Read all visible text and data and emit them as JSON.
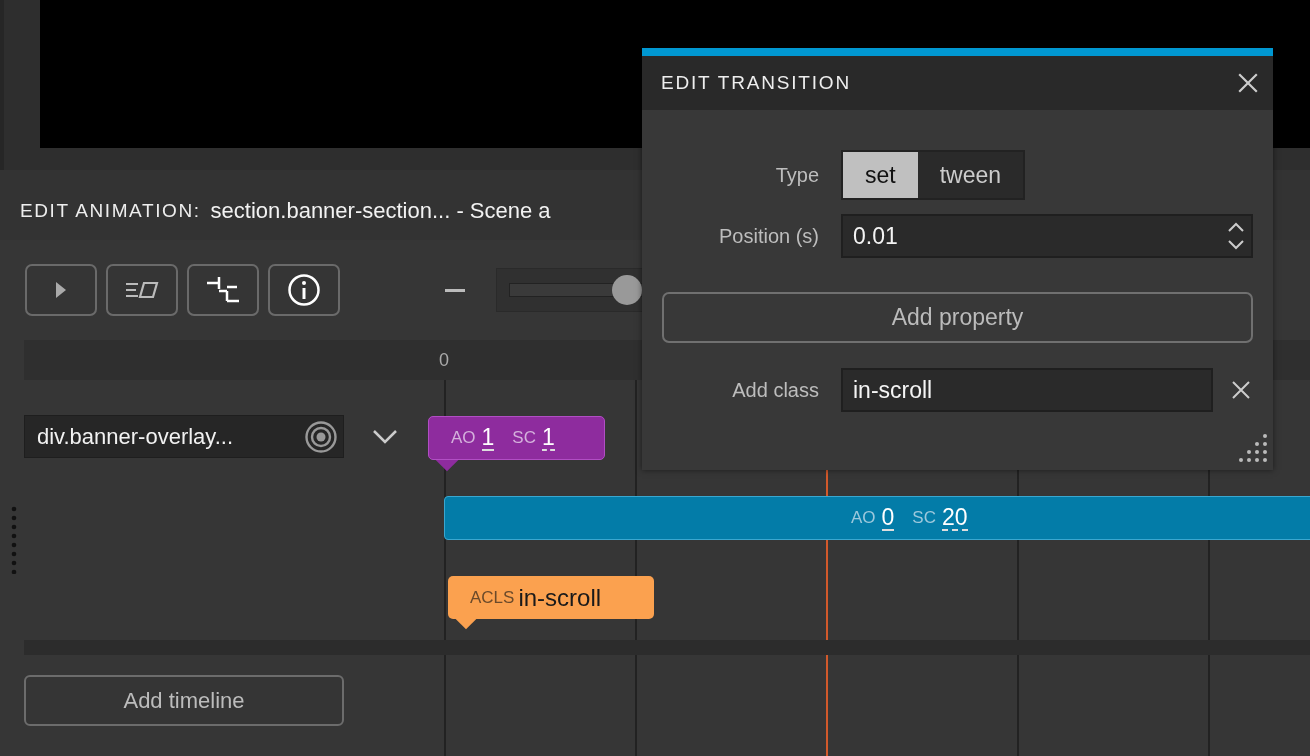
{
  "panel": {
    "heading": "EDIT ANIMATION:",
    "title": "section.banner-section... - Scene a"
  },
  "toolbar": [
    {
      "kind": "play"
    },
    {
      "kind": "ease"
    },
    {
      "kind": "tree"
    },
    {
      "kind": "info"
    }
  ],
  "zoom": {
    "level": 0.83
  },
  "ruler": {
    "labels": [
      "0"
    ]
  },
  "track": {
    "element": "div.banner-overlay..."
  },
  "keyframes": [
    {
      "kind": "props",
      "color": "#8e2c9e",
      "properties": [
        {
          "label": "AO",
          "value": "1"
        },
        {
          "label": "SC",
          "value": "1"
        }
      ]
    },
    {
      "kind": "bar",
      "color": "#037ca8",
      "properties": [
        {
          "label": "AO",
          "value": "0"
        },
        {
          "label": "SC",
          "value": "20"
        }
      ]
    },
    {
      "kind": "class",
      "color": "#fba14f",
      "label": "ACLS",
      "value": "in-scroll"
    }
  ],
  "add_timeline": "Add timeline",
  "dialog": {
    "title": "EDIT TRANSITION",
    "type_label": "Type",
    "type_options": [
      {
        "label": "set",
        "selected": true
      },
      {
        "label": "tween",
        "selected": false
      }
    ],
    "position_label": "Position (s)",
    "position_value": "0.01",
    "add_property": "Add property",
    "class_label": "Add class",
    "class_value": "in-scroll"
  }
}
